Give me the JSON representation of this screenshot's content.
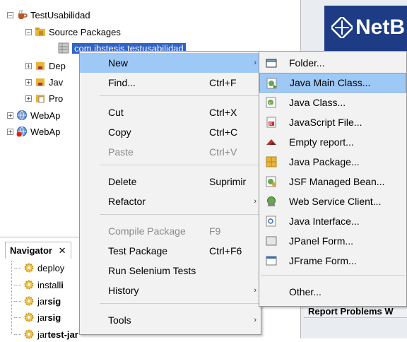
{
  "tree": {
    "project": "TestUsabilidad",
    "source_packages": "Source Packages",
    "selected_package": "com.ibstesis.testusabilidad",
    "partial_items": [
      "Dep",
      "Jav",
      "Pro"
    ],
    "webapps": [
      "WebAp",
      "WebAp"
    ]
  },
  "navigator": {
    "tab_label": "Navigator",
    "items": [
      {
        "label": "deploy",
        "bold": ""
      },
      {
        "label": "install ",
        "bold": "i"
      },
      {
        "label": "jar ",
        "bold": "sig"
      },
      {
        "label": "jar ",
        "bold": "sig"
      },
      {
        "label": "jar ",
        "bold": "test-jar"
      }
    ]
  },
  "right_panel": {
    "banner_text": "NetB",
    "report_label": "Report Problems W"
  },
  "context_menu": {
    "items": [
      {
        "label": "New",
        "shortcut": "",
        "submenu": true,
        "highlighted": true
      },
      {
        "label": "Find...",
        "shortcut": "Ctrl+F"
      },
      {
        "label": "Cut",
        "shortcut": "Ctrl+X"
      },
      {
        "label": "Copy",
        "shortcut": "Ctrl+C"
      },
      {
        "label": "Paste",
        "shortcut": "Ctrl+V",
        "disabled": true
      },
      {
        "label": "Delete",
        "shortcut": "Suprimir"
      },
      {
        "label": "Refactor",
        "shortcut": "",
        "submenu": true
      },
      {
        "label": "Compile Package",
        "shortcut": "F9",
        "disabled": true
      },
      {
        "label": "Test Package",
        "shortcut": "Ctrl+F6"
      },
      {
        "label": "Run Selenium Tests",
        "shortcut": ""
      },
      {
        "label": "History",
        "shortcut": "",
        "submenu": true
      },
      {
        "label": "Tools",
        "shortcut": "",
        "submenu": true
      }
    ]
  },
  "submenu": {
    "items": [
      {
        "label": "Folder...",
        "icon": "folder-icon"
      },
      {
        "label": "Java Main Class...",
        "icon": "java-main-class-icon",
        "highlighted": true
      },
      {
        "label": "Java Class...",
        "icon": "java-class-icon"
      },
      {
        "label": "JavaScript File...",
        "icon": "javascript-file-icon"
      },
      {
        "label": "Empty report...",
        "icon": "report-icon"
      },
      {
        "label": "Java Package...",
        "icon": "package-icon"
      },
      {
        "label": "JSF Managed Bean...",
        "icon": "bean-icon"
      },
      {
        "label": "Web Service Client...",
        "icon": "web-service-icon"
      },
      {
        "label": "Java Interface...",
        "icon": "interface-icon"
      },
      {
        "label": "JPanel Form...",
        "icon": "jpanel-icon"
      },
      {
        "label": "JFrame Form...",
        "icon": "jframe-icon"
      },
      {
        "label": "Other...",
        "icon": ""
      }
    ]
  },
  "colors": {
    "menu_bg": "#f2f2f2",
    "highlight": "#9ec8f5",
    "selection": "#2f63c9",
    "banner": "#1d3c85"
  }
}
